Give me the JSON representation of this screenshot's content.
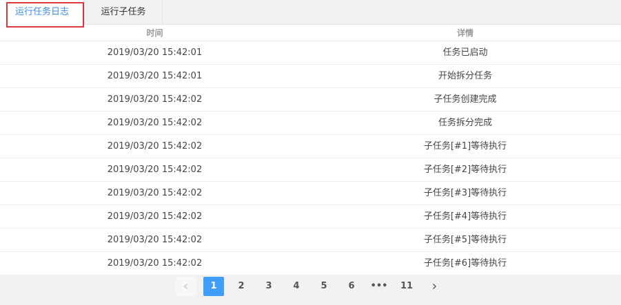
{
  "tabs": [
    {
      "label": "运行任务日志",
      "active": true
    },
    {
      "label": "运行子任务",
      "active": false
    }
  ],
  "table": {
    "columns": [
      "时间",
      "详情"
    ],
    "rows": [
      {
        "time": "2019/03/20 15:42:01",
        "detail": "任务已启动"
      },
      {
        "time": "2019/03/20 15:42:01",
        "detail": "开始拆分任务"
      },
      {
        "time": "2019/03/20 15:42:02",
        "detail": "子任务创建完成"
      },
      {
        "time": "2019/03/20 15:42:02",
        "detail": "任务拆分完成"
      },
      {
        "time": "2019/03/20 15:42:02",
        "detail": "子任务[#1]等待执行"
      },
      {
        "time": "2019/03/20 15:42:02",
        "detail": "子任务[#2]等待执行"
      },
      {
        "time": "2019/03/20 15:42:02",
        "detail": "子任务[#3]等待执行"
      },
      {
        "time": "2019/03/20 15:42:02",
        "detail": "子任务[#4]等待执行"
      },
      {
        "time": "2019/03/20 15:42:02",
        "detail": "子任务[#5]等待执行"
      },
      {
        "time": "2019/03/20 15:42:02",
        "detail": "子任务[#6]等待执行"
      }
    ]
  },
  "pagination": {
    "prev_icon": "chevron-left-icon",
    "next_icon": "chevron-right-icon",
    "pages": [
      "1",
      "2",
      "3",
      "4",
      "5",
      "6",
      "•••",
      "11"
    ],
    "current_page": "1"
  },
  "colors": {
    "accent": "#409eff",
    "tab_active_text": "#3a8ee6",
    "highlight_border": "#d9363e"
  }
}
